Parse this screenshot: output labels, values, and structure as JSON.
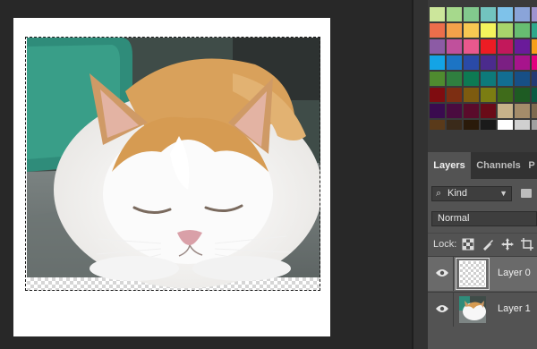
{
  "document": {
    "subject": "cat-photo"
  },
  "swatches": {
    "rows": [
      [
        "#cce69b",
        "#a6d98c",
        "#82c98d",
        "#72c4bf",
        "#7ec2ea",
        "#8aa4d9",
        "#9f93cf"
      ],
      [
        "#ec6e4b",
        "#f3a14a",
        "#f7c852",
        "#f4f35c",
        "#a8d46b",
        "#67bd71",
        "#2ea88b"
      ],
      [
        "#8c5ba5",
        "#c0509c",
        "#e9588d",
        "#ec1c24",
        "#c2185b",
        "#6a1b9a",
        "#f6a01a"
      ],
      [
        "#13a4e6",
        "#1c74c4",
        "#2a4aa7",
        "#4b2b8d",
        "#7b1f83",
        "#a7148c",
        "#e4007f"
      ],
      [
        "#4f8b2f",
        "#2f7f3f",
        "#0d7a53",
        "#0d7a7a",
        "#126e92",
        "#174f86",
        "#243a74"
      ],
      [
        "#7f0c10",
        "#7d2e12",
        "#7d5b0f",
        "#7b7d12",
        "#3f6b1a",
        "#1e5b23",
        "#0b5a43"
      ],
      [
        "#3a0b4f",
        "#4a0b3f",
        "#5a0b2b",
        "#6a0b18",
        "#c7b28a",
        "#a48c6a",
        "#7f6a4f"
      ],
      [
        "#5a3a1a",
        "#3a2a1a",
        "#2a1a0a",
        "#1a1a1a",
        "#ffffff",
        "#d0d0d0",
        "#a0a0a0"
      ]
    ]
  },
  "tabs": [
    {
      "label": "Layers",
      "active": true
    },
    {
      "label": "Channels",
      "active": false
    },
    {
      "label": "P",
      "active": false
    }
  ],
  "filter": {
    "kind_label": "Kind",
    "search_icon": "search-icon",
    "chevron_icon": "chevron-down-icon"
  },
  "blend_mode": {
    "value": "Normal"
  },
  "lock": {
    "label": "Lock:",
    "icons": [
      "lock-transparent-pixels-icon",
      "lock-image-pixels-icon",
      "lock-position-icon",
      "lock-artboard-icon"
    ]
  },
  "layers": [
    {
      "name": "Layer 0",
      "selected": true,
      "visible": true,
      "thumbnail": "transparent-thumbnail"
    },
    {
      "name": "Layer 1",
      "selected": false,
      "visible": true,
      "thumbnail": "cat-thumbnail"
    }
  ]
}
